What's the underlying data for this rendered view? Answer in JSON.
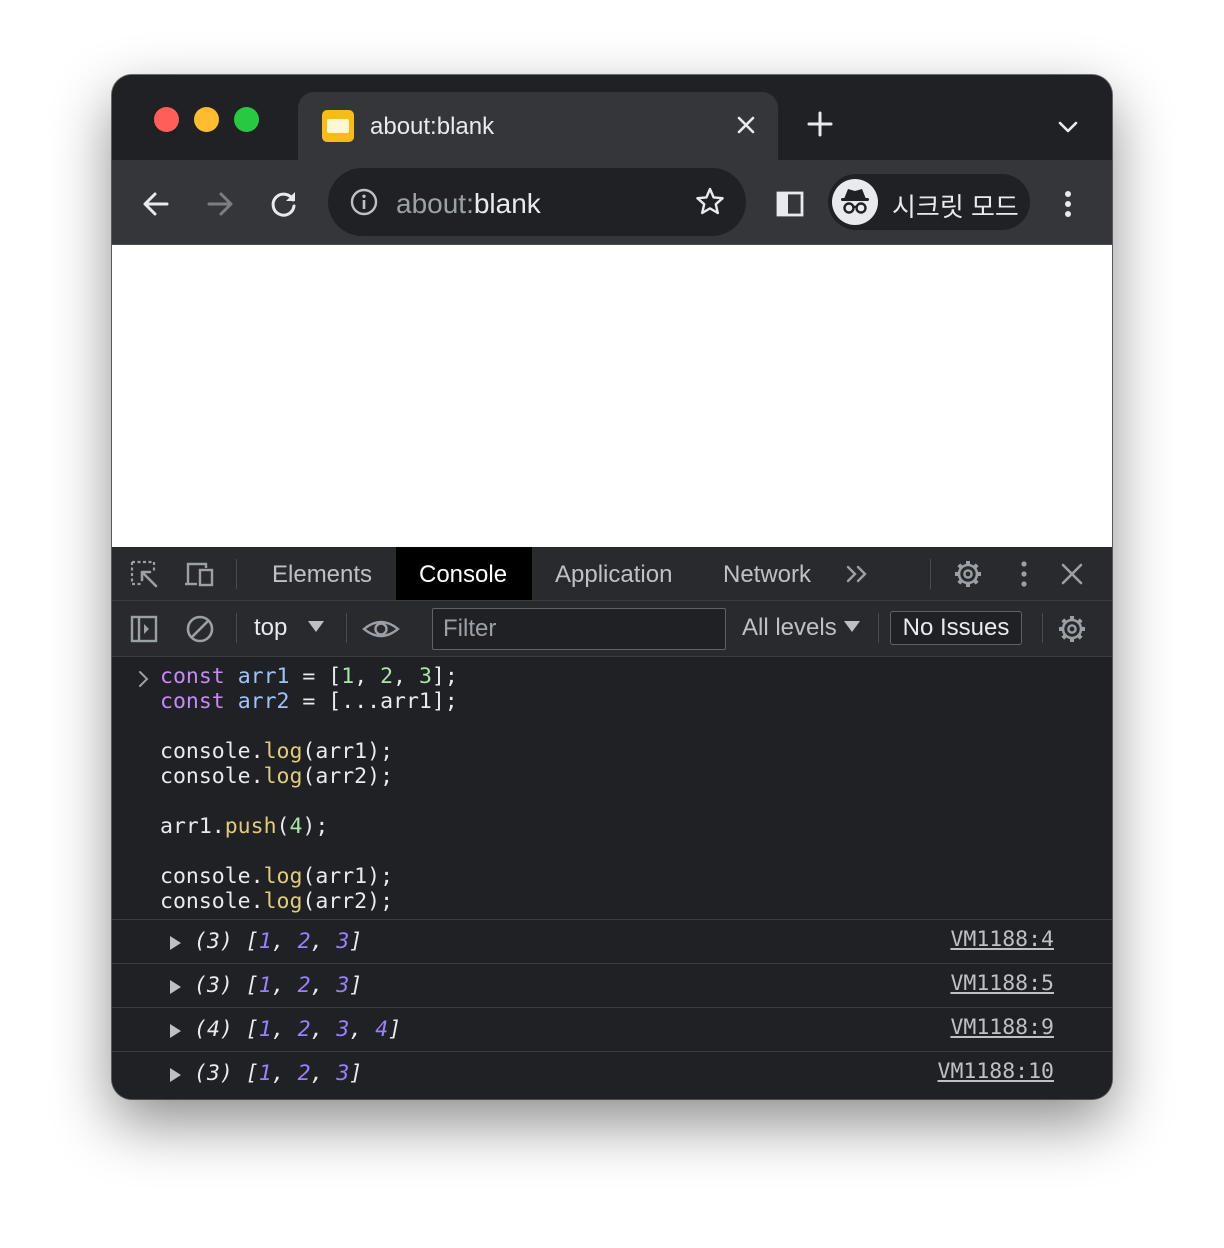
{
  "tab": {
    "title": "about:blank",
    "close_icon": "close-icon",
    "favicon": "page-favicon-icon"
  },
  "omnibox": {
    "scheme": "about:",
    "host": "blank"
  },
  "incognito": {
    "label": "시크릿 모드"
  },
  "devtools": {
    "tabs": [
      "Elements",
      "Console",
      "Application",
      "Network"
    ],
    "active_tab": "Console",
    "context": "top",
    "filter_placeholder": "Filter",
    "levels": "All levels",
    "issues": "No Issues"
  },
  "console": {
    "code_lines": [
      "const arr1 = [1, 2, 3];",
      "const arr2 = [...arr1];",
      "",
      "console.log(arr1);",
      "console.log(arr2);",
      "",
      "arr1.push(4);",
      "",
      "console.log(arr1);",
      "console.log(arr2);"
    ],
    "logs": [
      {
        "count": "(3)",
        "values": [
          "1",
          "2",
          "3"
        ],
        "source": "VM1188:4"
      },
      {
        "count": "(3)",
        "values": [
          "1",
          "2",
          "3"
        ],
        "source": "VM1188:5"
      },
      {
        "count": "(4)",
        "values": [
          "1",
          "2",
          "3",
          "4"
        ],
        "source": "VM1188:9"
      },
      {
        "count": "(3)",
        "values": [
          "1",
          "2",
          "3"
        ],
        "source": "VM1188:10"
      }
    ]
  },
  "colors": {
    "traffic_red": "#ff5f57",
    "traffic_yellow": "#febc2e",
    "traffic_green": "#28c840",
    "keyword": "#c58af9",
    "variable": "#9cc4fb",
    "number": "#a8e6a3",
    "function": "#e0cc7a",
    "log_number": "#9980ff"
  }
}
